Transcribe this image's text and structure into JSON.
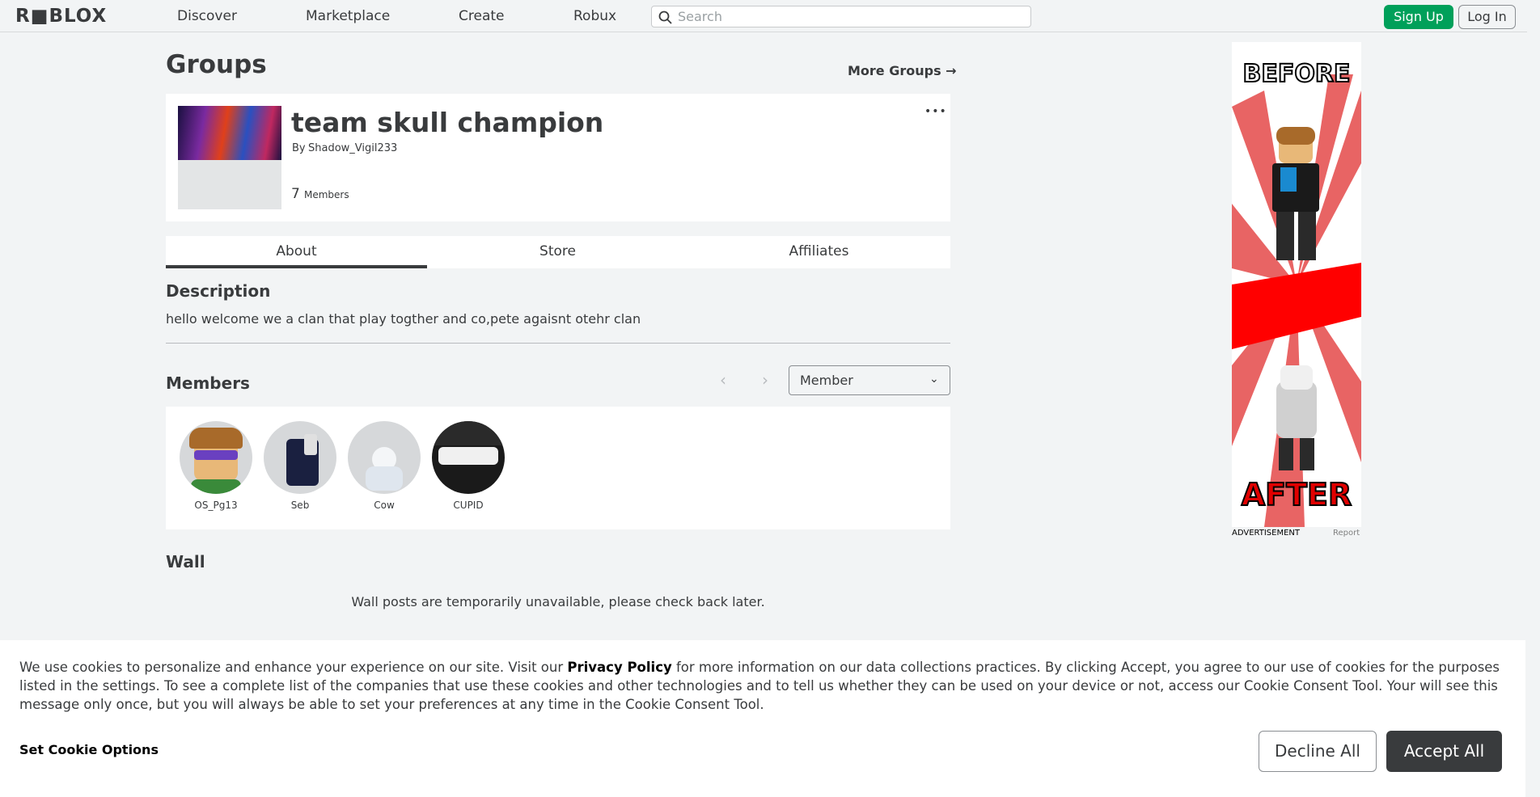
{
  "header": {
    "logo": "R■BLOX",
    "nav": [
      "Discover",
      "Marketplace",
      "Create",
      "Robux"
    ],
    "search_placeholder": "Search",
    "signup": "Sign Up",
    "login": "Log In"
  },
  "page": {
    "title": "Groups",
    "more_groups": "More Groups →"
  },
  "group": {
    "name": "team skull champion",
    "owner_prefix": "By",
    "owner": "Shadow_Vigil233",
    "member_count": "7",
    "member_count_label": "Members",
    "more_icon": "•••"
  },
  "tabs": [
    "About",
    "Store",
    "Affiliates"
  ],
  "description": {
    "title": "Description",
    "text": "hello welcome we a clan that play togther and co,pete agaisnt otehr clan"
  },
  "members": {
    "title": "Members",
    "role": "Member",
    "list": [
      {
        "name": "OS_Pg13"
      },
      {
        "name": "Seb"
      },
      {
        "name": "Cow"
      },
      {
        "name": "CUPID"
      }
    ]
  },
  "wall": {
    "title": "Wall",
    "text": "Wall posts are temporarily unavailable, please check back later."
  },
  "ad": {
    "before": "BEFORE",
    "after": "AFTER",
    "label": "ADVERTISEMENT",
    "report": "Report"
  },
  "cookie": {
    "text_1": "We use cookies to personalize and enhance your experience on our site. Visit our ",
    "link": "Privacy Policy",
    "text_2": " for more information on our data collections practices. By clicking Accept, you agree to our use of cookies for the purposes listed in the settings. To see a complete list of the companies that use these cookies and other technologies and to tell us whether they can be used on your device or not, access our Cookie Consent Tool. Your will see this message only once, but you will always be able to set your preferences at any time in the Cookie Consent Tool.",
    "options": "Set Cookie Options",
    "decline": "Decline All",
    "accept": "Accept All"
  }
}
